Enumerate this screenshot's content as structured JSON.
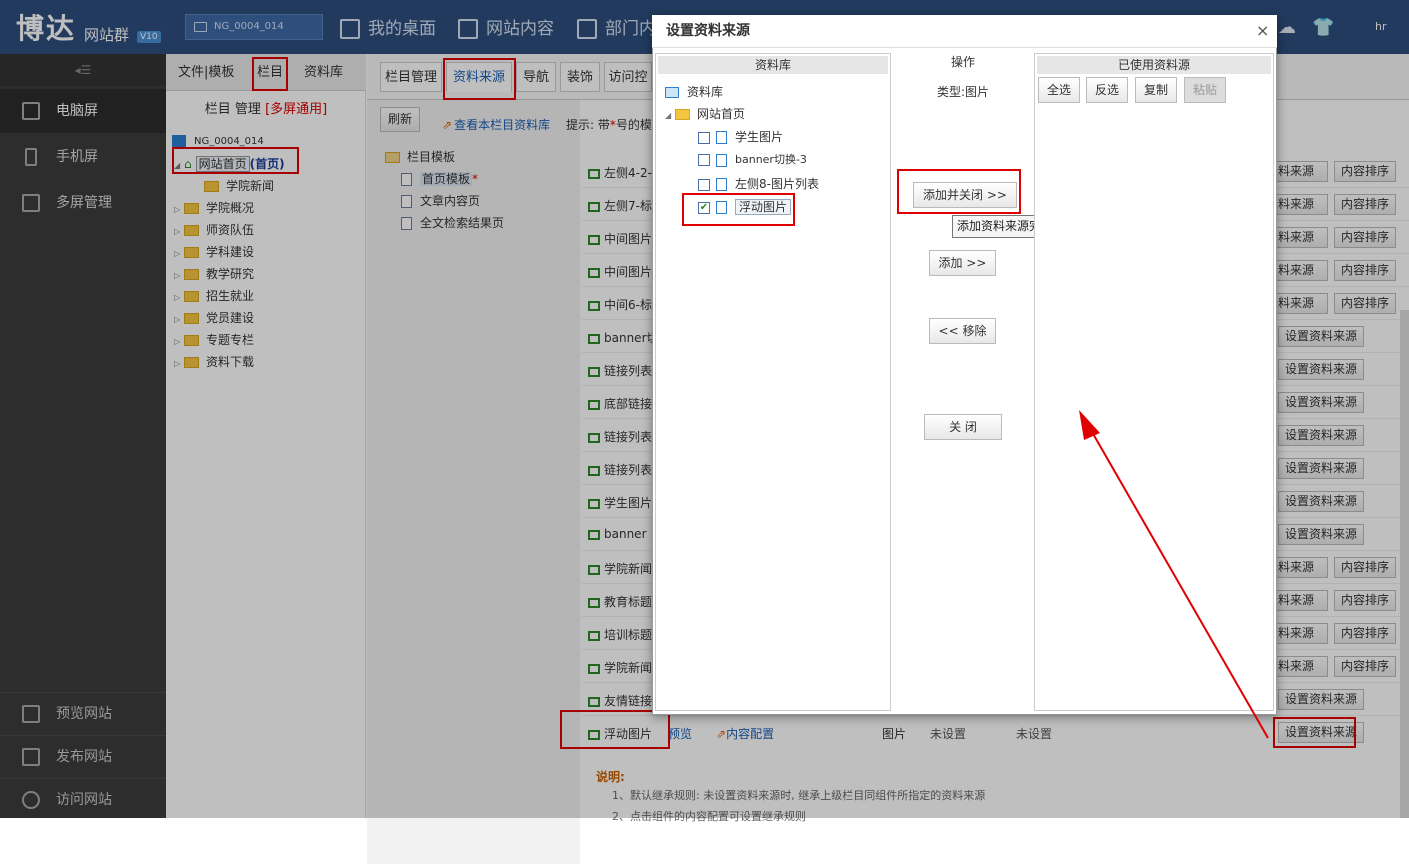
{
  "topbar": {
    "logo": "博达",
    "logo_sub": "网站群",
    "logo_ver": "V10",
    "site_select": "NG_0004_014",
    "nav": [
      "我的桌面",
      "网站内容",
      "部门内"
    ],
    "user": "hr"
  },
  "leftnav": {
    "collapse": "◂☰",
    "items": [
      "电脑屏",
      "手机屏",
      "多屏管理"
    ],
    "bottom": [
      "预览网站",
      "发布网站",
      "访问网站"
    ]
  },
  "tree": {
    "tabs": [
      "文件|模板",
      "栏目",
      "资料库"
    ],
    "title": "栏目 管理",
    "title_tag": "[多屏通用]",
    "root": "NG_0004_014",
    "home": "网站首页",
    "home_tag": "(首页)",
    "child": "学院新闻",
    "nodes": [
      "学院概况",
      "师资队伍",
      "学科建设",
      "教学研究",
      "招生就业",
      "党员建设",
      "专题专栏",
      "资料下载"
    ]
  },
  "main": {
    "tabs": [
      "栏目管理",
      "资料来源",
      "导航",
      "装饰",
      "访问控"
    ],
    "refresh": "刷新",
    "view_link": "查看本栏目资料库",
    "hint": "提示: 带",
    "hint_star": "*",
    "hint_rest": "号的模",
    "templates_title": "栏目模板",
    "templates": [
      "首页模板",
      "文章内容页",
      "全文检索结果页"
    ],
    "template_star": "*"
  },
  "rows": [
    {
      "label": "左侧4-2-",
      "btn1": "资料来源",
      "btn2": "内容排序"
    },
    {
      "label": "左侧7-标",
      "btn1": "资料来源",
      "btn2": "内容排序"
    },
    {
      "label": "中间图片",
      "btn1": "资料来源",
      "btn2": "内容排序"
    },
    {
      "label": "中间图片",
      "btn1": "资料来源",
      "btn2": "内容排序"
    },
    {
      "label": "中间6-标",
      "btn1": "资料来源",
      "btn2": "内容排序"
    },
    {
      "label": "banner切",
      "btn1": "设置资料来源",
      "btn2": ""
    },
    {
      "label": "链接列表",
      "btn1": "设置资料来源",
      "btn2": ""
    },
    {
      "label": "底部链接",
      "btn1": "设置资料来源",
      "btn2": ""
    },
    {
      "label": "链接列表",
      "btn1": "设置资料来源",
      "btn2": ""
    },
    {
      "label": "链接列表",
      "btn1": "设置资料来源",
      "btn2": ""
    },
    {
      "label": "学生图片",
      "btn1": "设置资料来源",
      "btn2": ""
    },
    {
      "label": "banner",
      "btn1": "设置资料来源",
      "btn2": ""
    },
    {
      "label": "学院新闻",
      "btn1": "资料来源",
      "btn2": "内容排序"
    },
    {
      "label": "教育标题",
      "btn1": "资料来源",
      "btn2": "内容排序"
    },
    {
      "label": "培训标题",
      "btn1": "资料来源",
      "btn2": "内容排序"
    },
    {
      "label": "学院新闻",
      "btn1": "资料来源",
      "btn2": "内容排序"
    },
    {
      "label": "友情链接",
      "btn1": "设置资料来源",
      "btn2": ""
    }
  ],
  "float_row": {
    "label": "浮动图片",
    "preview": "预览",
    "config": "内容配置",
    "type": "图片",
    "s1": "未设置",
    "s2": "未设置",
    "btn": "设置资料来源"
  },
  "notes": {
    "title": "说明:",
    "line1": "1、默认继承规则: 未设置资料来源时, 继承上级栏目同组件所指定的资料来源",
    "line2": "2、点击组件的内容配置可设置继承规则"
  },
  "dialog": {
    "title": "设置资料来源",
    "close": "×",
    "lib_header": "资料库",
    "lib_root": "资料库",
    "lib_folder": "网站首页",
    "lib_items": [
      "学生图片",
      "banner切换-3",
      "左侧8-图片列表",
      "浮动图片"
    ],
    "ops_header": "操作",
    "ops_type": "类型:图片",
    "add_close": "添加并关闭 >>",
    "add": "添加 >>",
    "remove": "<< 移除",
    "close_btn": "关 闭",
    "tooltip": "添加资料来源完成后关闭窗口,方便操作",
    "used_header": "已使用资料源",
    "used_btns": [
      "全选",
      "反选",
      "复制",
      "粘贴"
    ]
  },
  "colors": {
    "topbar": "#2d4e7e",
    "leftnav": "#3c3c3c",
    "highlight": "#e00000",
    "link": "#1a5fb4"
  }
}
